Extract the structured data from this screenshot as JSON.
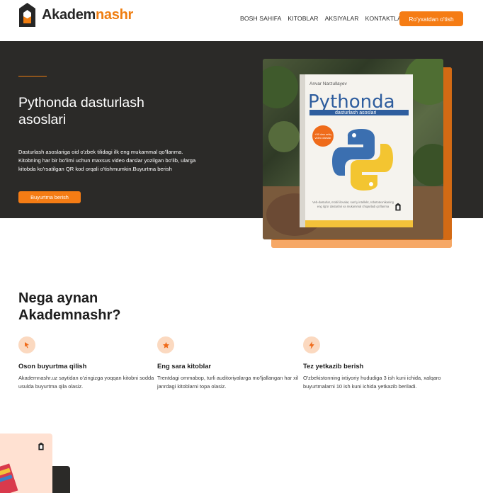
{
  "header": {
    "logo": {
      "text_dark": "Akadem",
      "text_accent": "nashr",
      "icon": "akademnashr-logo-icon"
    },
    "nav": [
      {
        "label": "BOSH SAHIFA"
      },
      {
        "label": "KITOBLAR"
      },
      {
        "label": "AKSIYALAR"
      },
      {
        "label": "KONTAKTLAR"
      }
    ],
    "login_label": "Ro'yxatdan o'tish"
  },
  "hero": {
    "title": "Pythonda dasturlash asoslari",
    "description": "Dasturlash asoslariga oid o'zbek tilidagi ilk eng mukammal qo'llanma. Kitobning har bir bo'limi uchun maxsus video darslar yozilgan bo'lib, ularga kitobda ko'rsatilgan QR kod orqali o'tishmumkin.Buyurtma berish",
    "button_label": "Buyurtma berish",
    "book": {
      "author": "Anvar Narzullayev",
      "title": "Pythonda",
      "subtitle": "dasturlash asoslari",
      "badge": "+50 dan ortiq video darslar",
      "blurb": "Veb-dasturlar, mobil ilovalar, sun'iy intellekt, robototexnikaning eng ilg'or dasturlari va mukammal chiqariladi qo'llanma"
    }
  },
  "why": {
    "title": "Nega aynan Akademnashr?",
    "features": [
      {
        "icon": "cursor-icon",
        "title": "Oson buyurtma qilish",
        "desc": "Akademnashr.uz saytidan o'zingizga yoqqan kitobni sodda usulda buyurtma qila olasiz."
      },
      {
        "icon": "star-icon",
        "title": "Eng sara kitoblar",
        "desc": "Trentdagi ommabop, turli auditoriyalarga mo'ljallangan har xil janrdagi kitoblarni topa olasiz."
      },
      {
        "icon": "lightning-icon",
        "title": "Tez yetkazib berish",
        "desc": "O'zbekistonning ixtiyoriy hududiga 3 ish kuni ichida, xalqaro buyurtmalarni 10 ish kuni ichida yetkazib beriladi."
      }
    ]
  },
  "colors": {
    "accent": "#f57c14",
    "dark": "#2b2a28",
    "soft": "#fbd9c0"
  }
}
